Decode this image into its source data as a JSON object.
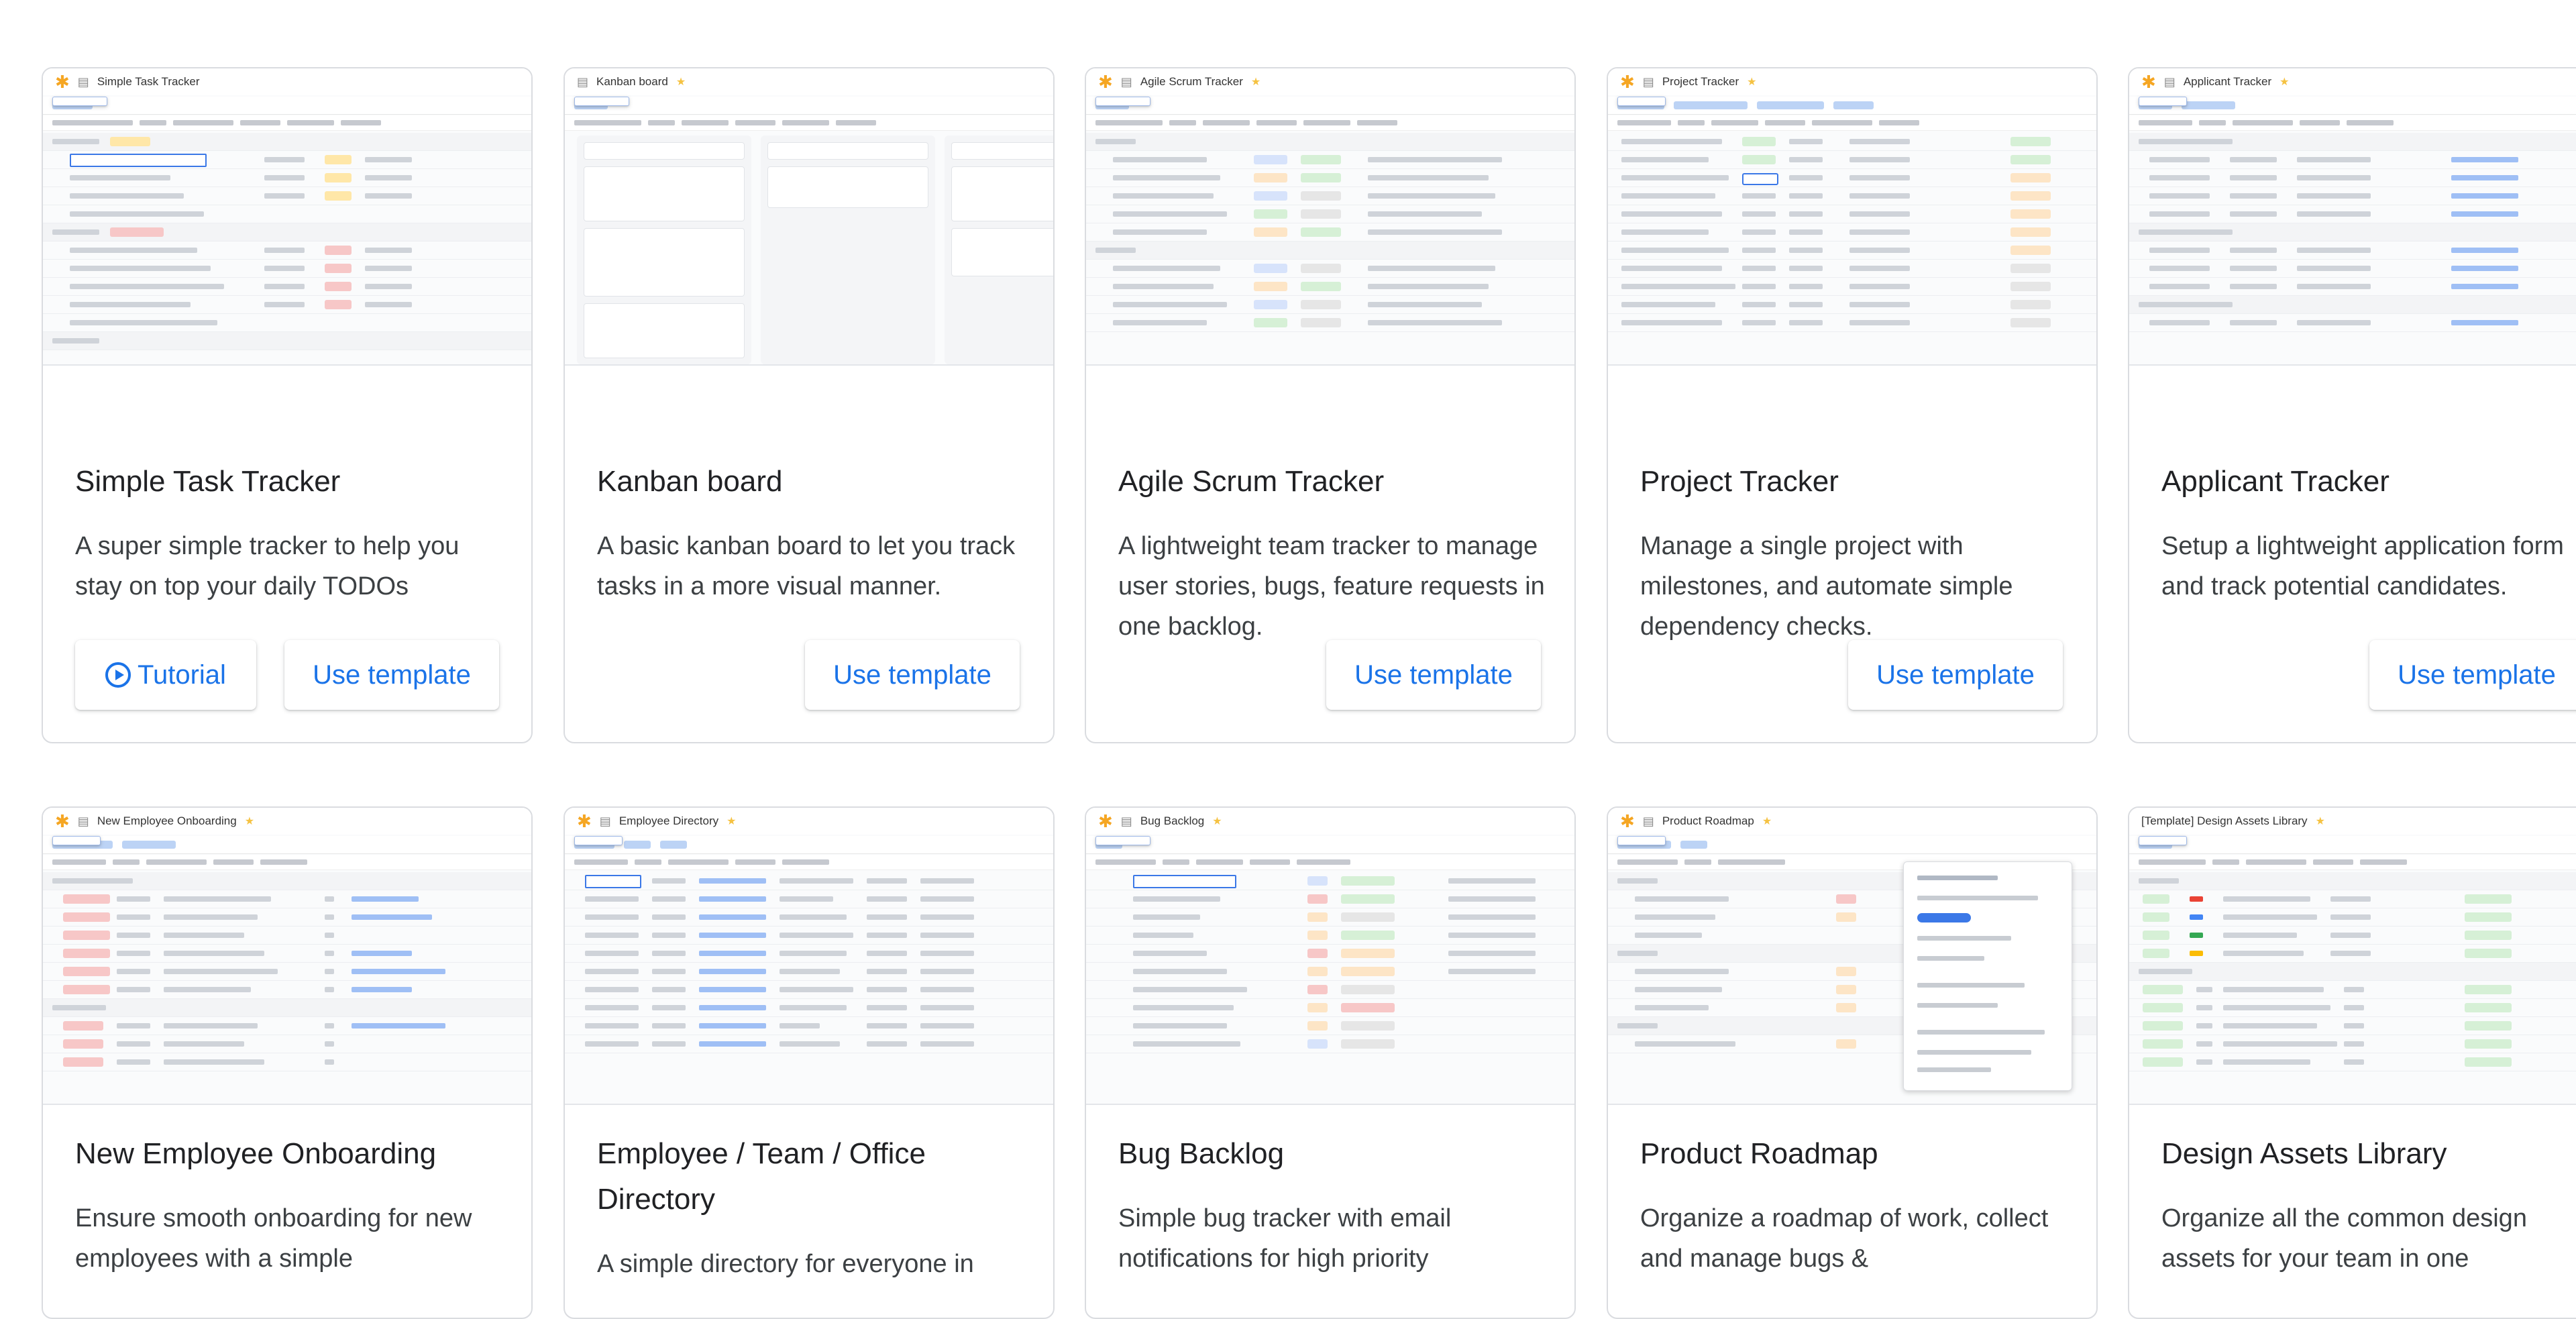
{
  "row1": [
    {
      "thumb_title": "Simple Task Tracker",
      "title": "Simple Task Tracker",
      "description": "A super simple tracker to help you stay on top your daily TODOs",
      "tutorial_label": "Tutorial",
      "use_label": "Use template"
    },
    {
      "thumb_title": "Kanban board",
      "title": "Kanban board",
      "description": "A basic kanban board to let you track tasks in a more visual manner.",
      "use_label": "Use template"
    },
    {
      "thumb_title": "Agile Scrum Tracker",
      "title": "Agile Scrum Tracker",
      "description": "A lightweight team tracker to manage user stories, bugs, feature requests in one backlog.",
      "use_label": "Use template"
    },
    {
      "thumb_title": "Project Tracker",
      "title": "Project Tracker",
      "description": "Manage a single project with milestones, and automate simple dependency checks.",
      "use_label": "Use template"
    },
    {
      "thumb_title": "Applicant Tracker",
      "title": "Applicant Tracker",
      "description": "Setup a lightweight application form and track potential candidates.",
      "use_label": "Use template"
    }
  ],
  "row2": [
    {
      "thumb_title": "New Employee Onboarding",
      "title": "New Employee Onboarding",
      "description": "Ensure smooth onboarding for new employees with a simple"
    },
    {
      "thumb_title": "Employee Directory",
      "title": "Employee / Team / Office Directory",
      "description": "A simple directory for everyone in"
    },
    {
      "thumb_title": "Bug Backlog",
      "title": "Bug Backlog",
      "description": "Simple bug tracker with email notifications for high priority"
    },
    {
      "thumb_title": "Product Roadmap",
      "title": "Product Roadmap",
      "description": "Organize a roadmap of work, collect and manage bugs &"
    },
    {
      "thumb_title": "[Template] Design Assets Library",
      "title": "Design Assets Library",
      "description": "Organize all the common design assets for your team in one"
    }
  ],
  "icons": {
    "logo": "app-logo-icon",
    "doc": "document-icon",
    "star": "star-icon",
    "play": "play-circle-icon"
  },
  "colors": {
    "accent": "#1a73e8",
    "border": "#dadce0",
    "logo": "#f5a623"
  }
}
